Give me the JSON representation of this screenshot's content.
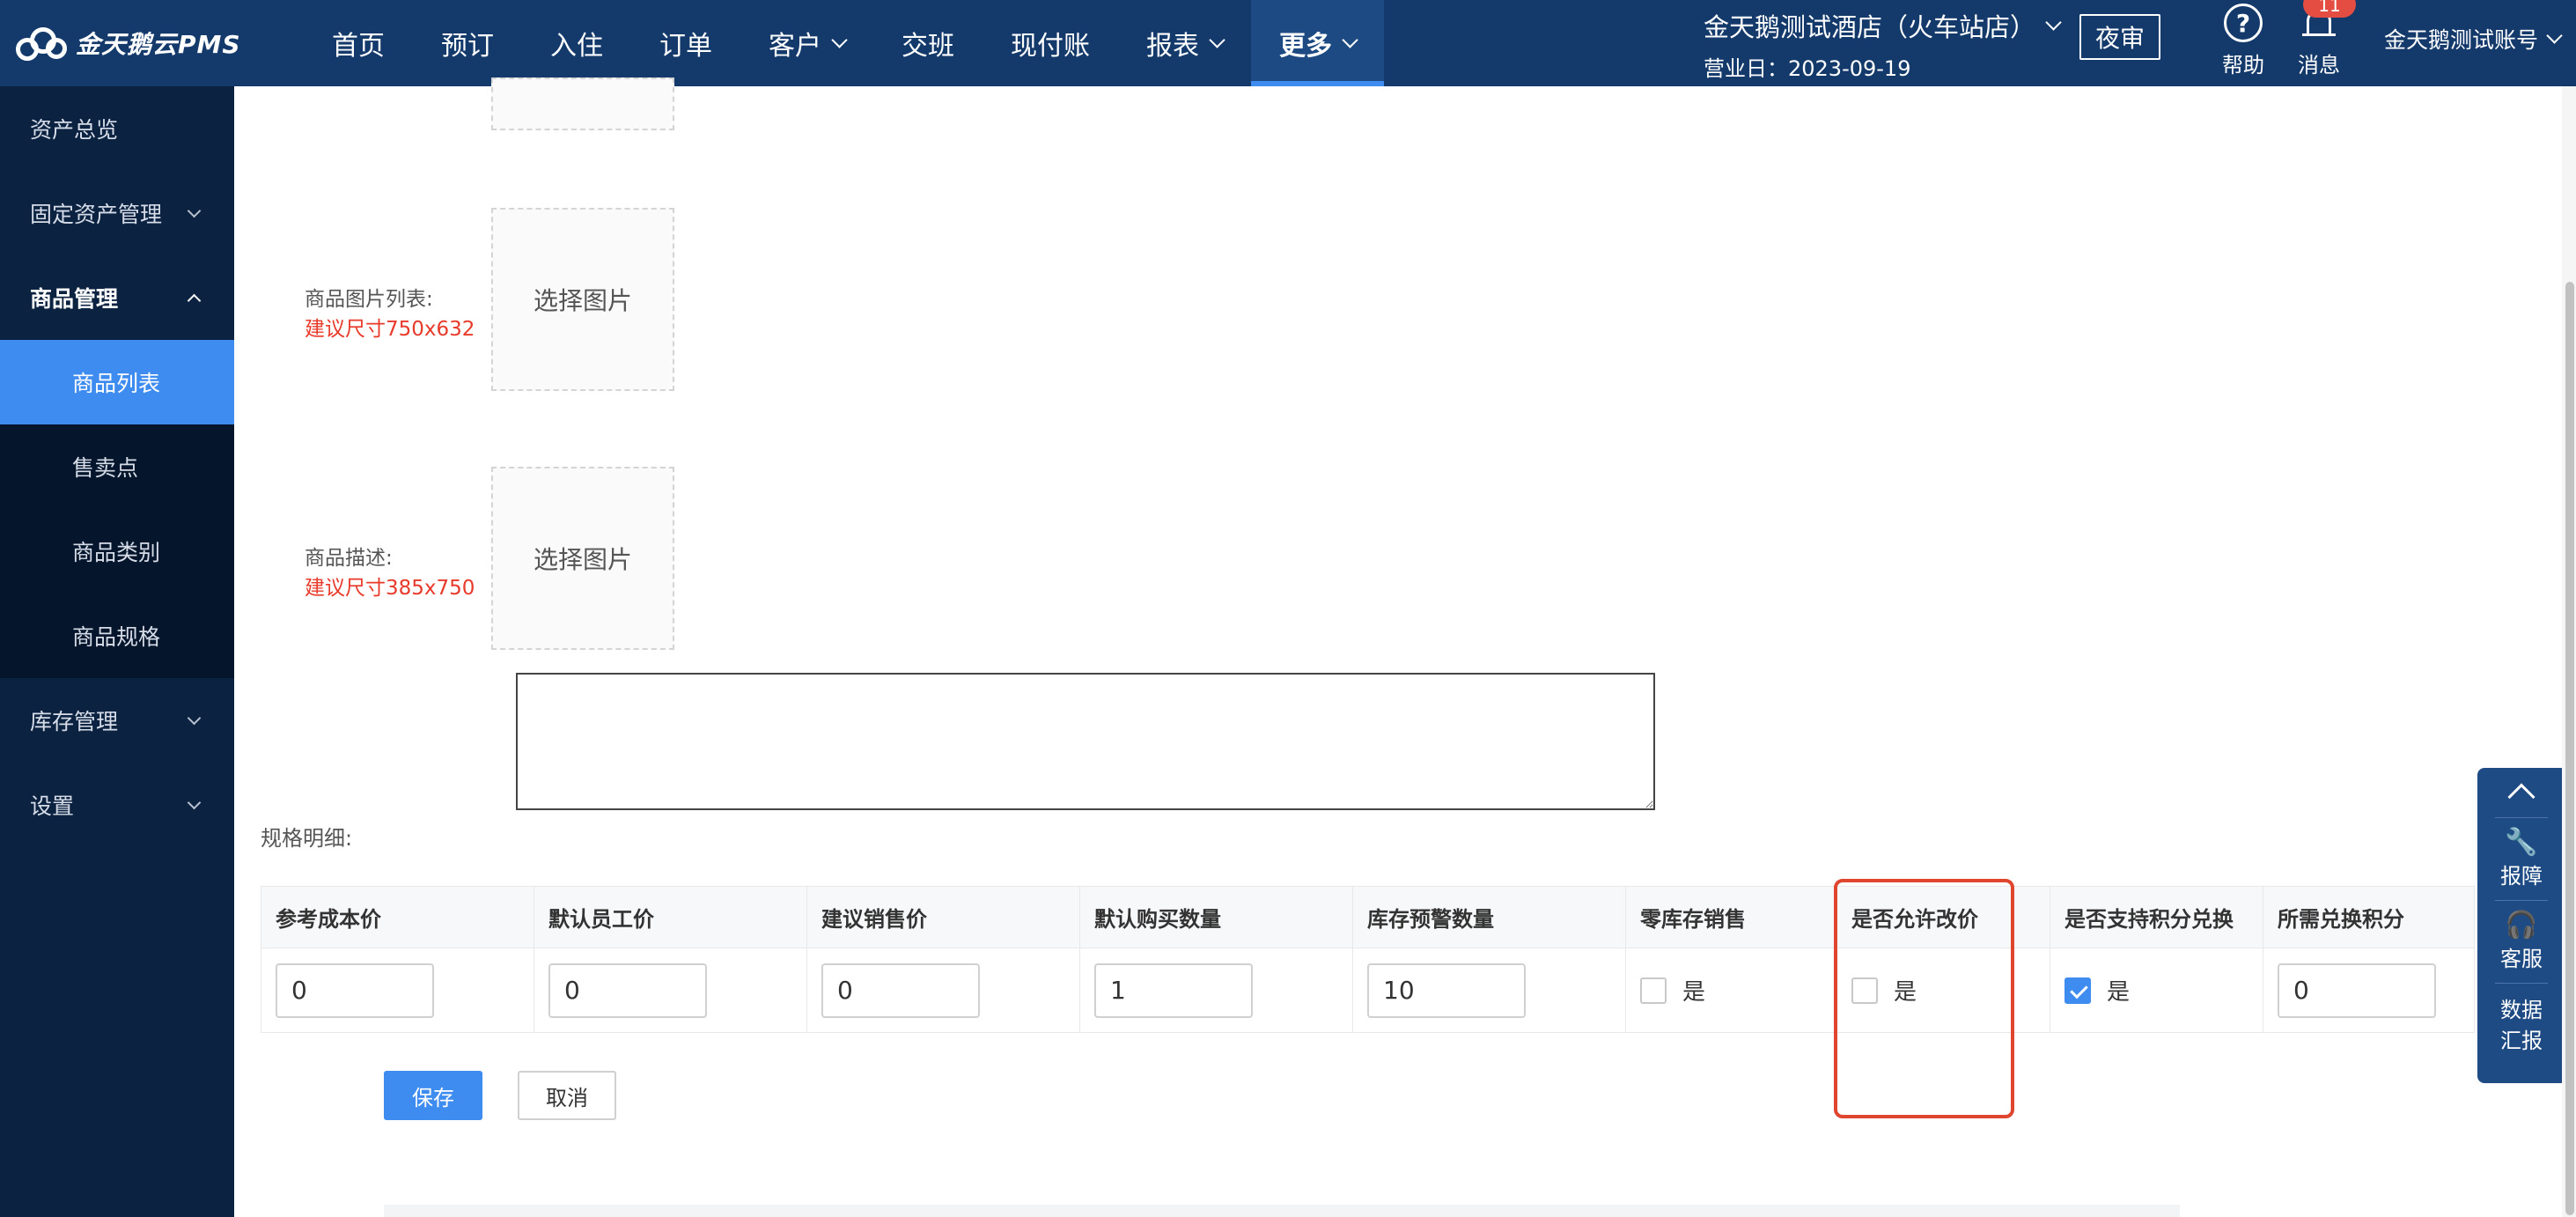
{
  "app": {
    "logo_text": "金天鹅云PMS"
  },
  "topnav": {
    "items": [
      {
        "label": "首页",
        "has_caret": false
      },
      {
        "label": "预订",
        "has_caret": false
      },
      {
        "label": "入住",
        "has_caret": false
      },
      {
        "label": "订单",
        "has_caret": false
      },
      {
        "label": "客户",
        "has_caret": true
      },
      {
        "label": "交班",
        "has_caret": false
      },
      {
        "label": "现付账",
        "has_caret": false
      },
      {
        "label": "报表",
        "has_caret": true
      },
      {
        "label": "更多",
        "has_caret": true,
        "active": true
      }
    ],
    "hotel_name": "金天鹅测试酒店（火车站店）",
    "business_date": "营业日：2023-09-19",
    "night_audit_label": "夜审",
    "help_label": "帮助",
    "messages_label": "消息",
    "messages_badge": "11",
    "account_label": "金天鹅测试账号"
  },
  "sidebar": {
    "items": [
      {
        "label": "资产总览"
      },
      {
        "label": "固定资产管理"
      },
      {
        "label": "商品管理"
      },
      {
        "label": "库存管理"
      },
      {
        "label": "设置"
      }
    ],
    "submenu": [
      {
        "label": "商品列表",
        "active": true
      },
      {
        "label": "售卖点"
      },
      {
        "label": "商品类别"
      },
      {
        "label": "商品规格"
      }
    ]
  },
  "form": {
    "image_list_label": "商品图片列表:",
    "image_list_hint": "建议尺寸750x632",
    "image_list_button": "选择图片",
    "description_label": "商品描述:",
    "description_hint": "建议尺寸385x750",
    "description_button": "选择图片",
    "description_text": "",
    "spec_label": "规格明细:",
    "save_label": "保存",
    "cancel_label": "取消"
  },
  "spec_table": {
    "columns": [
      "参考成本价",
      "默认员工价",
      "建议销售价",
      "默认购买数量",
      "库存预警数量",
      "零库存销售",
      "是否允许改价",
      "是否支持积分兑换",
      "所需兑换积分"
    ],
    "row": {
      "cost_price": "0",
      "staff_price": "0",
      "suggested_price": "0",
      "default_qty": "1",
      "stock_alert_qty": "10",
      "zero_stock_sale": {
        "label": "是",
        "checked": false
      },
      "allow_price_change": {
        "label": "是",
        "checked": false
      },
      "points_exchange": {
        "label": "是",
        "checked": true
      },
      "points_required": "0"
    }
  },
  "float_panel": {
    "report_label": "报障",
    "service_label": "客服",
    "data_report_label_1": "数据",
    "data_report_label_2": "汇报"
  }
}
